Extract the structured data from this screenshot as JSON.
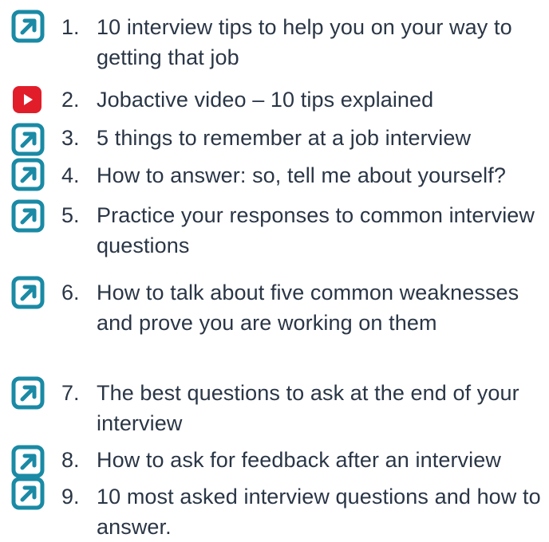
{
  "items": [
    {
      "number": "1.",
      "text": "10 interview tips to help you on your way to getting that job",
      "icon": "external-link-icon"
    },
    {
      "number": "2.",
      "text": "Jobactive video – 10 tips explained",
      "icon": "youtube-play-icon"
    },
    {
      "number": "3.",
      "text": "5 things to remember at a job interview",
      "icon": "external-link-icon"
    },
    {
      "number": "4.",
      "text": "How to answer: so, tell me about yourself?",
      "icon": "external-link-icon"
    },
    {
      "number": "5.",
      "text": "Practice your responses to common interview questions",
      "icon": "external-link-icon"
    },
    {
      "number": "6.",
      "text": "How to talk about five common weaknesses and prove you are working on them",
      "icon": "external-link-icon"
    },
    {
      "number": "7.",
      "text": "The best questions to ask at the end of your interview",
      "icon": "external-link-icon"
    },
    {
      "number": "8.",
      "text": "How to ask for feedback after an interview",
      "icon": "external-link-icon"
    },
    {
      "number": "9.",
      "text": "10 most asked interview questions and how to answer.",
      "icon": "external-link-icon"
    }
  ],
  "colors": {
    "link_icon": "#1a8aa5",
    "video_icon": "#e11d2a",
    "text": "#2a3646"
  }
}
